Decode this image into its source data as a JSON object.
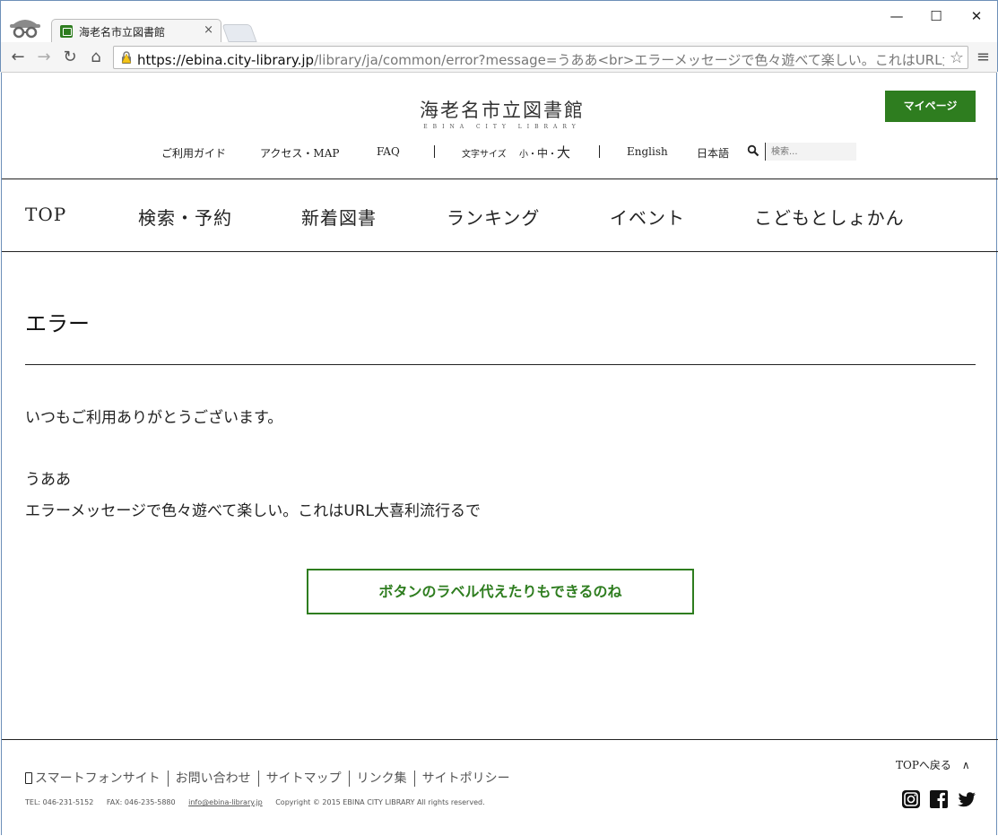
{
  "browser": {
    "tab_title": "海老名市立図書館",
    "tab_close": "×",
    "url_scheme_host": "https://ebina.city-library.jp",
    "url_path": "/library/ja/common/error?message=うああ<br>エラーメッセージで色々遊べて楽しい。これはURL大喜利流行る",
    "window_controls": {
      "minimize": "—",
      "maximize": "☐",
      "close": "✕"
    },
    "nav_icons": {
      "back": "←",
      "forward": "→",
      "reload": "↻",
      "home": "⌂"
    },
    "bookmark_star": "☆",
    "menu_icon": "≡"
  },
  "header": {
    "logo_jp": "海老名市立図書館",
    "logo_en": "EBINA CITY LIBRARY",
    "mypage_label": "マイページ"
  },
  "utility": {
    "guide": "ご利用ガイド",
    "access": "アクセス・MAP",
    "faq": "FAQ",
    "font_size_label": "文字サイズ",
    "size_small": "小",
    "size_medium": "中",
    "size_large": "大",
    "english": "English",
    "japanese": "日本語",
    "search_placeholder": "検索..."
  },
  "global_nav": [
    "TOP",
    "検索・予約",
    "新着図書",
    "ランキング",
    "イベント",
    "こどもとしょかん"
  ],
  "main": {
    "title": "エラー",
    "greeting": "いつもご利用ありがとうございます。",
    "message_line1": "うああ",
    "message_line2": "エラーメッセージで色々遊べて楽しい。これはURL大喜利流行るで",
    "button_label": "ボタンのラベル代えたりもできるのね"
  },
  "footer": {
    "to_top": "TOPへ戻る　∧",
    "links": [
      "スマートフォンサイト",
      "お問い合わせ",
      "サイトマップ",
      "リンク集",
      "サイトポリシー"
    ],
    "tel": "TEL: 046-231-5152",
    "fax": "FAX: 046-235-5880",
    "email": "info@ebina-library.jp",
    "copyright": "Copyright © 2015 EBINA CITY LIBRARY All rights reserved."
  },
  "colors": {
    "brand_green": "#2e7d1f",
    "text": "#222222"
  },
  "icons": [
    "incognito-icon",
    "favicon-icon",
    "lock-warning-icon",
    "search-icon",
    "phone-icon",
    "instagram-icon",
    "facebook-icon",
    "twitter-icon"
  ]
}
